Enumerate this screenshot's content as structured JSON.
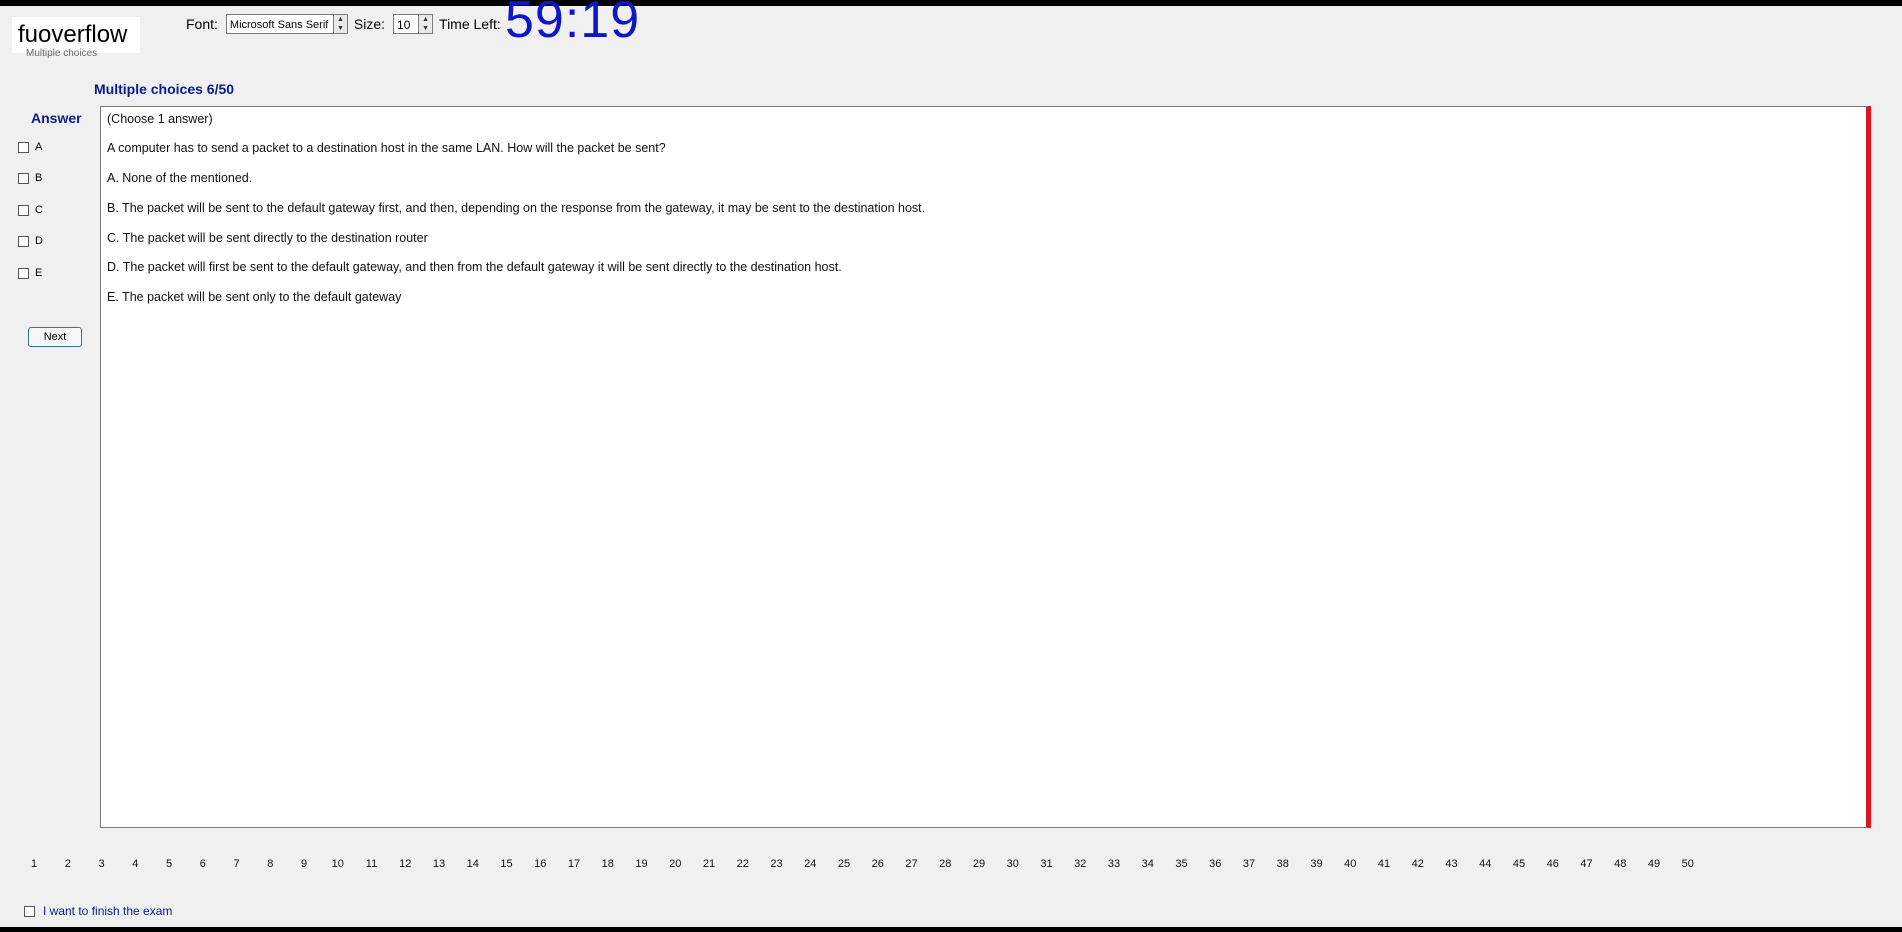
{
  "watermark": "fuoverflow",
  "sub_caption": "Multiple choices",
  "toolbar": {
    "font_label": "Font:",
    "font_value": "Microsoft Sans Serif",
    "size_label": "Size:",
    "size_value": "10",
    "time_label": "Time Left:",
    "timer": "59:19"
  },
  "question_title": "Multiple choices 6/50",
  "answer": {
    "label": "Answer",
    "options": [
      "A",
      "B",
      "C",
      "D",
      "E"
    ],
    "next_label": "Next"
  },
  "content": {
    "instruction": "(Choose 1 answer)",
    "question": "A computer has to send a packet to a destination host in the same LAN. How will the packet be sent?",
    "choices": [
      "A.  None of the mentioned.",
      "B.  The packet will be sent to the default gateway first, and then, depending on the response from the gateway, it may be sent to the destination host.",
      "C.  The packet will be sent directly to the destination router",
      "D.  The packet will first be sent to the default gateway, and then from the default gateway it will be sent directly to the destination host.",
      "E.  The packet will be sent only to the default gateway"
    ]
  },
  "pages": [
    "1",
    "2",
    "3",
    "4",
    "5",
    "6",
    "7",
    "8",
    "9",
    "10",
    "11",
    "12",
    "13",
    "14",
    "15",
    "16",
    "17",
    "18",
    "19",
    "20",
    "21",
    "22",
    "23",
    "24",
    "25",
    "26",
    "27",
    "28",
    "29",
    "30",
    "31",
    "32",
    "33",
    "34",
    "35",
    "36",
    "37",
    "38",
    "39",
    "40",
    "41",
    "42",
    "43",
    "44",
    "45",
    "46",
    "47",
    "48",
    "49",
    "50"
  ],
  "finish_label": "I want to finish the exam"
}
